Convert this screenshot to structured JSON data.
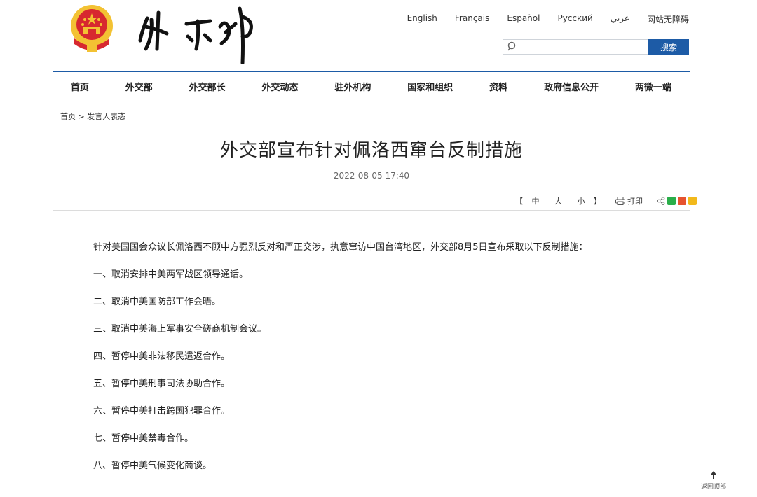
{
  "header": {
    "languages": [
      "English",
      "Français",
      "Español",
      "Русский",
      "عربي",
      "网站无障碍"
    ],
    "search": {
      "placeholder": "",
      "button_label": "搜索"
    }
  },
  "nav": {
    "items": [
      "首页",
      "外交部",
      "外交部长",
      "外交动态",
      "驻外机构",
      "国家和组织",
      "资料",
      "政府信息公开",
      "两微一端"
    ]
  },
  "breadcrumb": {
    "home": "首页",
    "separator": ">",
    "current": "发言人表态"
  },
  "article": {
    "title": "外交部宣布针对佩洛西窜台反制措施",
    "date": "2022-08-05 17:40",
    "font_size": {
      "open": "【",
      "large": "中",
      "medium": "大",
      "small": "小",
      "close": "】"
    },
    "print_label": "打印",
    "paragraphs": [
      "针对美国国会众议长佩洛西不顾中方强烈反对和严正交涉，执意窜访中国台湾地区，外交部8月5日宣布采取以下反制措施：",
      "一、取消安排中美两军战区领导通话。",
      "二、取消中美国防部工作会晤。",
      "三、取消中美海上军事安全磋商机制会议。",
      "四、暂停中美非法移民遣返合作。",
      "五、暂停中美刑事司法协助合作。",
      "六、暂停中美打击跨国犯罪合作。",
      "七、暂停中美禁毒合作。",
      "八、暂停中美气候变化商谈。"
    ]
  },
  "back_to_top": "返回顶部",
  "colors": {
    "accent": "#1d5ba6",
    "emblem_red": "#d7282f",
    "emblem_gold": "#f3c233"
  },
  "icons": [
    "national-emblem-icon",
    "search-icon",
    "printer-icon",
    "share-icon",
    "wechat-icon",
    "weibo-icon",
    "qzone-icon",
    "up-arrow-icon"
  ]
}
